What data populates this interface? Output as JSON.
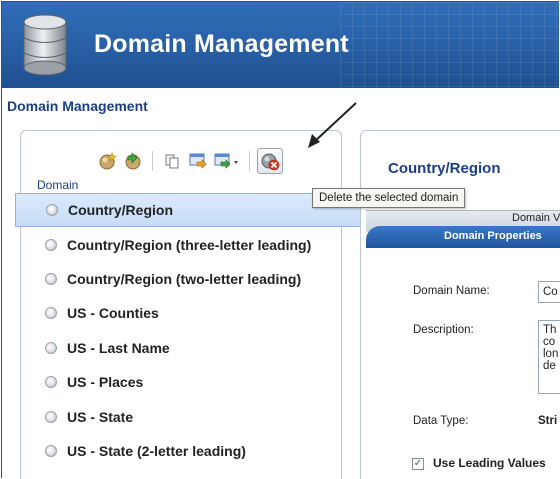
{
  "app": {
    "banner_title": "Domain Management",
    "page_heading": "Domain Management"
  },
  "toolbar": {
    "buttons": [
      {
        "icon": "create-domain-icon"
      },
      {
        "icon": "import-domain-icon"
      },
      {
        "icon": "copy-icon"
      },
      {
        "icon": "import-values-icon"
      },
      {
        "icon": "export-dropdown-icon"
      },
      {
        "icon": "delete-domain-icon"
      }
    ],
    "tooltip": "Delete the selected domain"
  },
  "domain_list": {
    "label": "Domain",
    "items": [
      {
        "label": "Country/Region",
        "selected": true
      },
      {
        "label": "Country/Region (three-letter leading)",
        "selected": false
      },
      {
        "label": "Country/Region (two-letter leading)",
        "selected": false
      },
      {
        "label": "US - Counties",
        "selected": false
      },
      {
        "label": "US - Last Name",
        "selected": false
      },
      {
        "label": "US - Places",
        "selected": false
      },
      {
        "label": "US - State",
        "selected": false
      },
      {
        "label": "US - State (2-letter leading)",
        "selected": false
      }
    ]
  },
  "details": {
    "title": "Country/Region",
    "tab_top": "Domain V",
    "tab_active": "Domain Properties",
    "domain_name_label": "Domain Name:",
    "domain_name_value": "Co",
    "description_label": "Description:",
    "description_lines": [
      "Th",
      "co",
      "lon",
      "de"
    ],
    "data_type_label": "Data Type:",
    "data_type_value": "Stri",
    "use_leading_label": "Use Leading Values",
    "use_leading_checked": true
  },
  "colors": {
    "banner": "#2a62a8",
    "heading": "#1b3f86",
    "selected_row": "#c7dcf7"
  }
}
